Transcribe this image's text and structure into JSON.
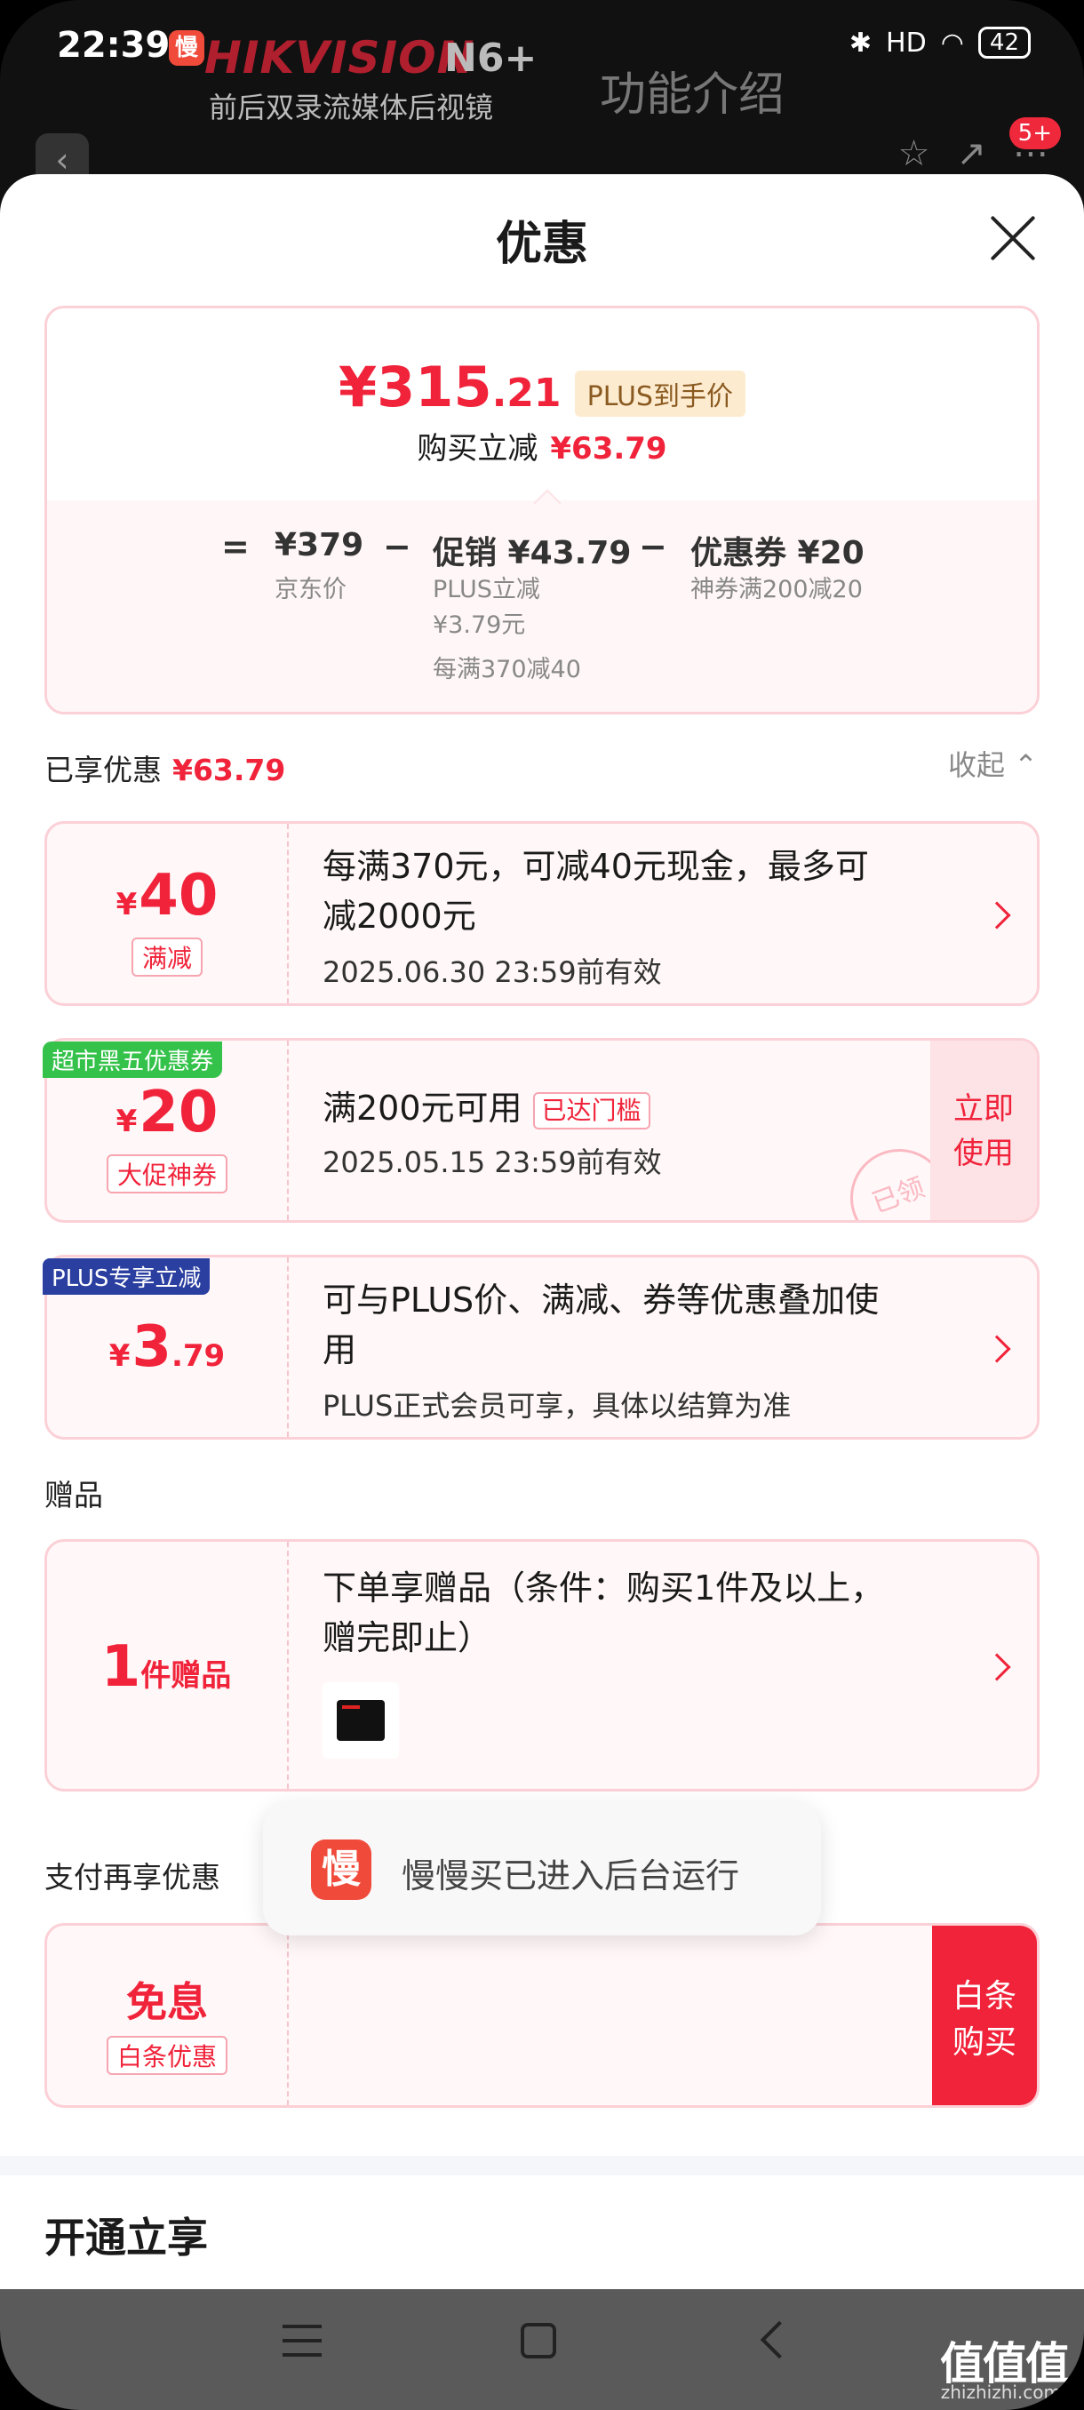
{
  "status_bar": {
    "time": "22:39",
    "app_badge": "慢",
    "network": "HD",
    "battery": "42"
  },
  "background_page": {
    "brand": "HIKVISION",
    "model": "N6+",
    "subtitle": "前后双录流媒体后视镜",
    "feature_title": "功能介绍",
    "badge": "5+"
  },
  "sheet": {
    "title": "优惠",
    "close_icon": "close-icon"
  },
  "summary": {
    "final_price_main": "¥315",
    "final_price_decimal": ".21",
    "plus_tag": "PLUS到手价",
    "instant_cut_label": "购买立减",
    "instant_cut_value": "¥63.79",
    "eq": "=",
    "minus1": "−",
    "minus2": "−",
    "jd_price": "¥379",
    "jd_price_label": "京东价",
    "promo": "促销 ¥43.79",
    "promo_sub1": "PLUS立减",
    "promo_sub2": "¥3.79元",
    "promo_sub3": "每满370减40",
    "coupon": "优惠券 ¥20",
    "coupon_sub": "神券满200减20"
  },
  "enjoyed": {
    "label": "已享优惠",
    "value": "¥63.79",
    "collapse": "收起 ⌃"
  },
  "cards": {
    "c1": {
      "yen": "¥",
      "amount": "40",
      "tag": "满减",
      "text1": "每满370元，可减40元现金，最多可",
      "text2": "减2000元",
      "valid": "2025.06.30 23:59前有效"
    },
    "c2": {
      "ribbon": "超市黑五优惠券",
      "yen": "¥",
      "amount": "20",
      "tag": "大促神券",
      "text": "满200元可用",
      "reach": "已达门槛",
      "valid": "2025.05.15 23:59前有效",
      "use_btn_1": "立即",
      "use_btn_2": "使用",
      "stamp": "已领"
    },
    "c3": {
      "ribbon": "PLUS专享立减",
      "yen": "¥",
      "amount": "3",
      "decimal": ".79",
      "text1": "可与PLUS价、满减、券等优惠叠加使",
      "text2": "用",
      "sub": "PLUS正式会员可享，具体以结算为准"
    }
  },
  "gift": {
    "label": "赠品",
    "count": "1",
    "unit": "件赠品",
    "text1": "下单享赠品（条件：购买1件及以上，",
    "text2": "赠完即止）"
  },
  "pay": {
    "label": "支付再享优惠",
    "title": "免息",
    "tag": "白条优惠",
    "btn1": "白条",
    "btn2": "购买"
  },
  "toast": {
    "icon": "慢",
    "text": "慢慢买已进入后台运行"
  },
  "open_title": "开通立享",
  "watermark": {
    "main": "值值值",
    "sub": "zhizhizhi.com"
  }
}
